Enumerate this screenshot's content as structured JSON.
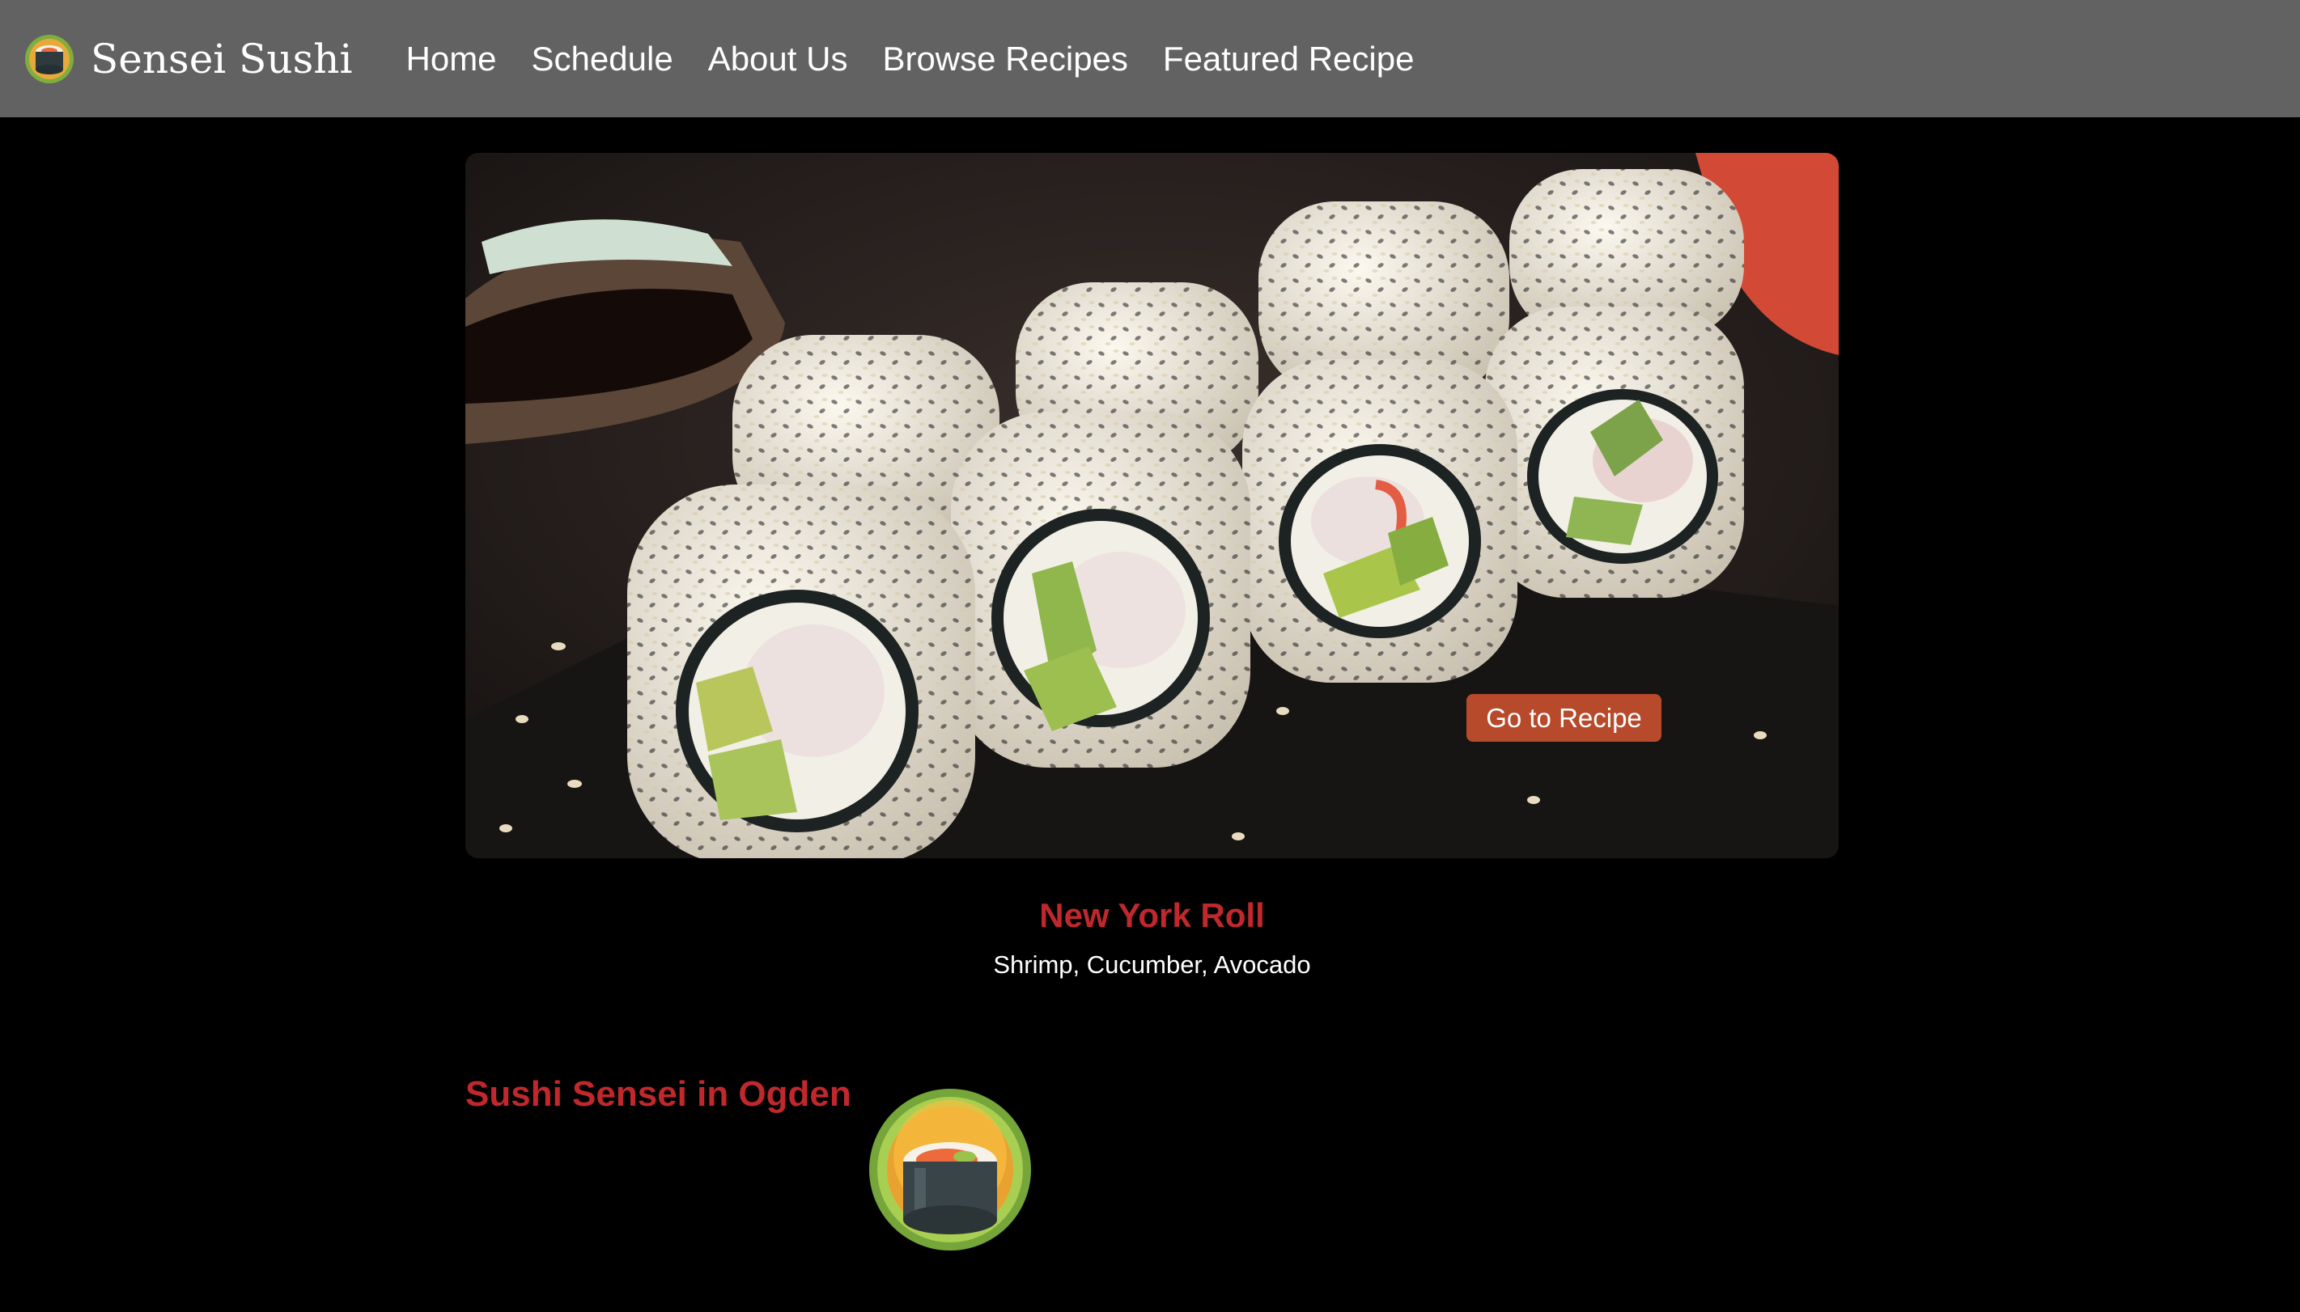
{
  "navbar": {
    "brand_name": "Sensei Sushi",
    "brand_icon": "sushi-roll-icon",
    "links": [
      "Home",
      "Schedule",
      "About Us",
      "Browse Recipes",
      "Featured Recipe"
    ]
  },
  "carousel": {
    "image": "sushi-rolls-photo",
    "button_label": "Go to Recipe",
    "title": "New York Roll",
    "ingredients": "Shrimp, Cucumber, Avocado"
  },
  "section": {
    "title": "Sushi Sensei in Ogden",
    "logo": "sushi-logo-icon"
  },
  "colors": {
    "navbar": "#626262",
    "background": "#000000",
    "accent_red": "#c0282c",
    "button": "#b84a2c"
  }
}
